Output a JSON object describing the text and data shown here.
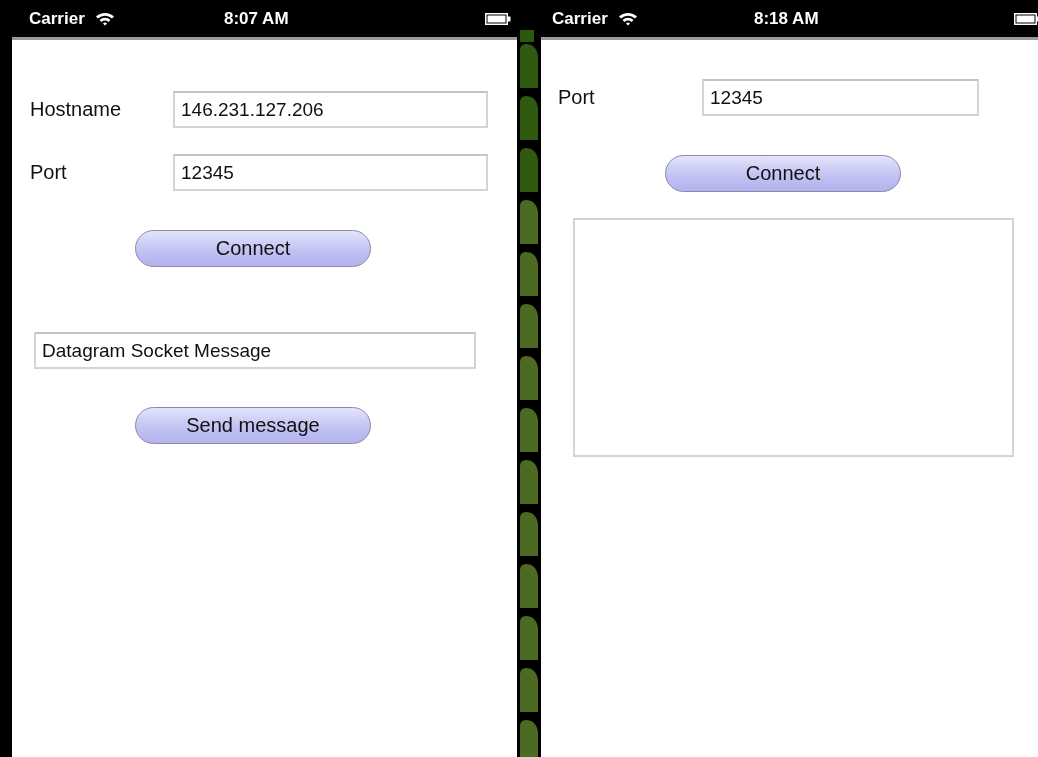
{
  "screens": [
    {
      "status_bar": {
        "carrier": "Carrier",
        "time": "8:07 AM"
      },
      "items": [
        {
          "kind": "labeled-field",
          "label": "Hostname",
          "value": "146.231.127.206"
        },
        {
          "kind": "labeled-field",
          "label": "Port",
          "value": "12345"
        },
        {
          "kind": "button",
          "label": "Connect"
        },
        {
          "kind": "field",
          "value": "Datagram Socket Message"
        },
        {
          "kind": "button",
          "label": "Send message"
        }
      ]
    },
    {
      "status_bar": {
        "carrier": "Carrier",
        "time": "8:18 AM"
      },
      "items": [
        {
          "kind": "labeled-field",
          "label": "Port",
          "value": "12345"
        },
        {
          "kind": "button",
          "label": "Connect"
        },
        {
          "kind": "text-area"
        }
      ]
    }
  ]
}
